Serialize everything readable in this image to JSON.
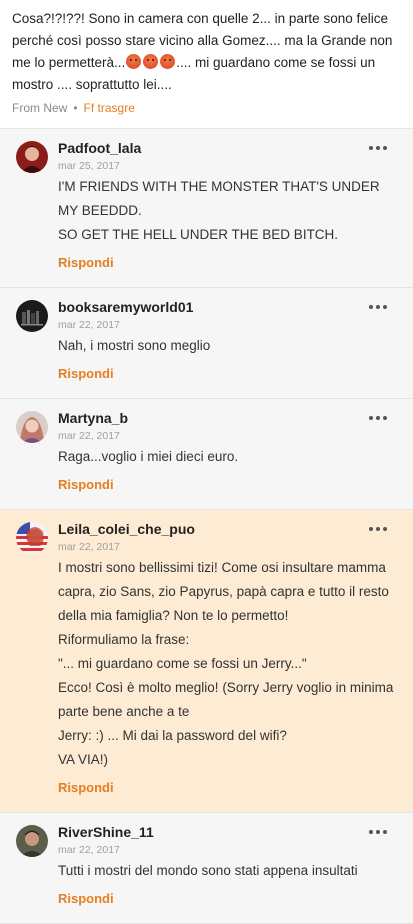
{
  "post": {
    "text_before_emoji": "Cosa?!?!??! Sono in camera con quelle 2... in parte sono felice perché così posso stare vicino alla Gomez.... ma la Grande non me lo permetterà...",
    "text_after_emoji": ".... mi guardano come se fossi un mostro .... soprattutto lei....",
    "emoji_icons": [
      "angry-face-icon",
      "angry-face-icon",
      "angry-face-icon"
    ],
    "source": "From New",
    "author": "Ff trasgre"
  },
  "reply_label": "Rispondi",
  "comments": [
    {
      "username": "Padfoot_lala",
      "date": "mar 25, 2017",
      "lines": [
        "I'M FRIENDS WITH THE MONSTER THAT'S UNDER MY BEEDDD.",
        "SO GET THE HELL UNDER THE BED BITCH."
      ],
      "avatar_icon": "avatar-red-portrait"
    },
    {
      "username": "booksaremyworld01",
      "date": "mar 22, 2017",
      "lines": [
        "Nah, i mostri sono meglio"
      ],
      "avatar_icon": "avatar-books-dark"
    },
    {
      "username": "Martyna_b",
      "date": "mar 22, 2017",
      "lines": [
        "Raga...voglio i miei dieci euro."
      ],
      "avatar_icon": "avatar-girl-portrait"
    },
    {
      "username": "Leila_colei_che_puo",
      "date": "mar 22, 2017",
      "lines": [
        "I mostri sono bellissimi tizi! Come osi insultare mamma capra, zio Sans, zio Papyrus, papà capra e tutto il resto della mia famiglia? Non te lo permetto!",
        "Riformuliamo la frase:",
        "\"... mi guardano come se fossi un Jerry...\"",
        "Ecco! Così è molto meglio! (Sorry Jerry voglio in minima parte bene anche a te",
        "Jerry: :) ... Mi dai la password del wifi?",
        "VA VIA!)"
      ],
      "avatar_icon": "avatar-flag-portrait",
      "highlight": true
    },
    {
      "username": "RiverShine_11",
      "date": "mar 22, 2017",
      "lines": [
        "Tutti i mostri del mondo sono stati appena insultati"
      ],
      "avatar_icon": "avatar-man-portrait"
    }
  ]
}
